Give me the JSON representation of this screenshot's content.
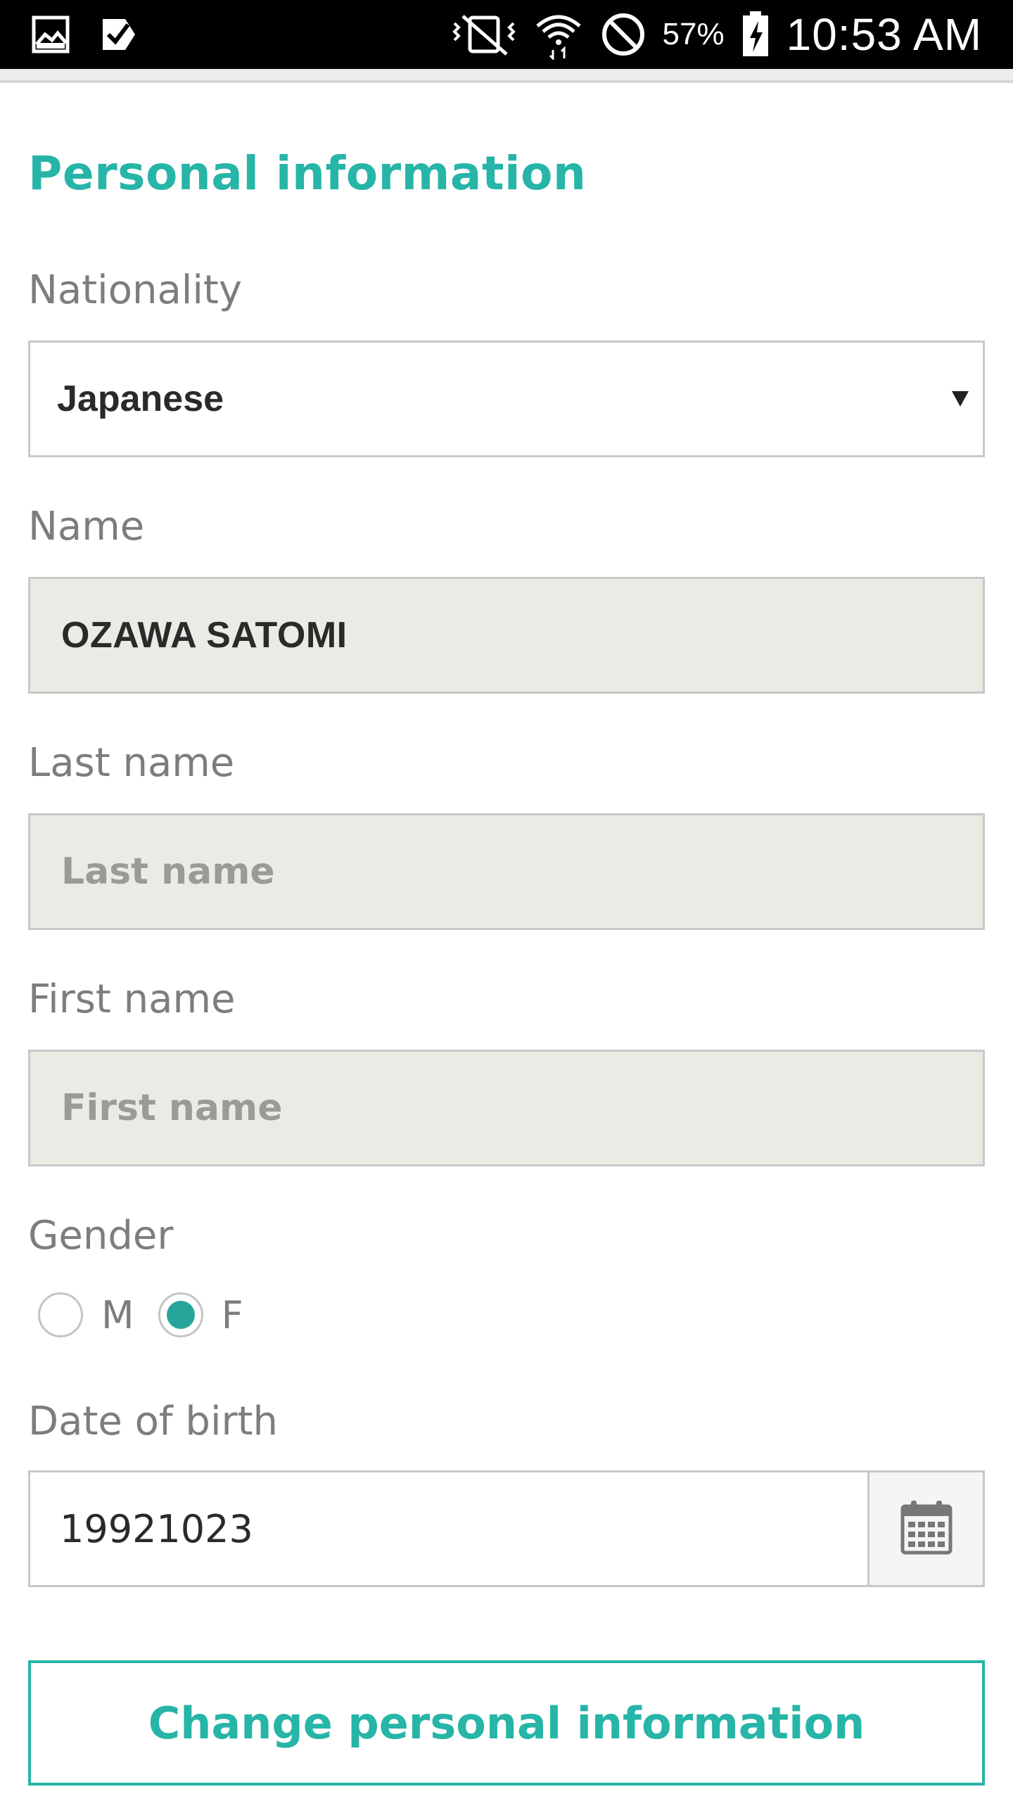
{
  "status_bar": {
    "icons_left": [
      "gallery-icon",
      "task-check-icon"
    ],
    "icons_right": [
      "mute-vibrate-icon",
      "wifi-icon",
      "do-not-disturb-icon",
      "battery-charging-icon"
    ],
    "battery": "57%",
    "time": "10:53 AM"
  },
  "form": {
    "section_title": "Personal information",
    "nationality": {
      "label": "Nationality",
      "value": "Japanese"
    },
    "name": {
      "label": "Name",
      "value": "OZAWA SATOMI"
    },
    "last_name": {
      "label": "Last name",
      "placeholder": "Last name"
    },
    "first_name": {
      "label": "First name",
      "placeholder": "First name"
    },
    "gender": {
      "label": "Gender",
      "options": [
        {
          "label": "M",
          "selected": false
        },
        {
          "label": "F",
          "selected": true
        }
      ]
    },
    "date_of_birth": {
      "label": "Date of birth",
      "value": "19921023",
      "icon": "calendar-icon"
    },
    "submit_label": "Change personal information"
  },
  "colors": {
    "accent": "#26b5a7",
    "readonly_bg": "#ebebe6",
    "border": "#c8c8c8",
    "label": "#7d7d7d"
  }
}
